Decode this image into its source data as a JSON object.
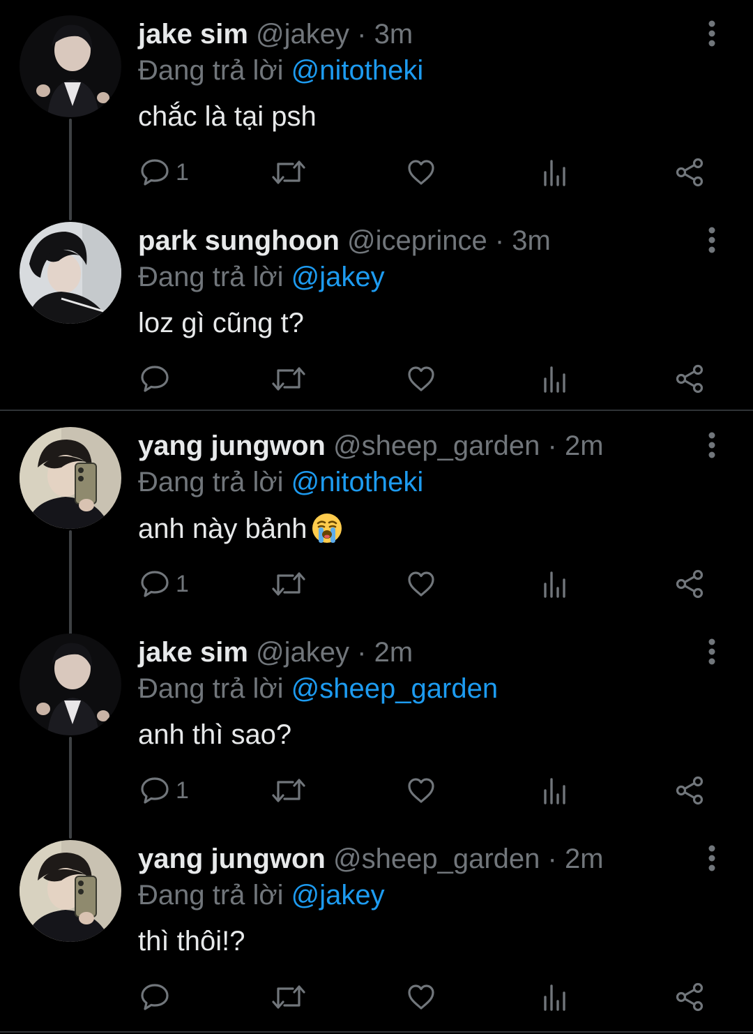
{
  "theme": {
    "background": "#000000",
    "text": "#e7e9ea",
    "muted": "#71767b",
    "link": "#1d9bf0",
    "divider": "#2f3336"
  },
  "tweets": [
    {
      "name": "jake sim",
      "handle": "@jakey",
      "separator": "·",
      "time": "3m",
      "reply_prefix": "Đang trả lời",
      "reply_to": "@nitotheki",
      "text": "chắc là tại psh",
      "emoji": "",
      "reply_count": "1",
      "avatar": "jake-sim-avatar"
    },
    {
      "name": "park sunghoon",
      "handle": "@iceprince",
      "separator": "·",
      "time": "3m",
      "reply_prefix": "Đang trả lời",
      "reply_to": "@jakey",
      "text": "loz gì cũng t?",
      "emoji": "",
      "reply_count": "",
      "avatar": "park-sunghoon-avatar"
    },
    {
      "name": "yang jungwon",
      "handle": "@sheep_garden",
      "separator": "·",
      "time": "2m",
      "reply_prefix": "Đang trả lời",
      "reply_to": "@nitotheki",
      "text": "anh này bảnh",
      "emoji": "loudly-crying-face",
      "reply_count": "1",
      "avatar": "yang-jungwon-avatar"
    },
    {
      "name": "jake sim",
      "handle": "@jakey",
      "separator": "·",
      "time": "2m",
      "reply_prefix": "Đang trả lời",
      "reply_to": "@sheep_garden",
      "text": "anh thì sao?",
      "emoji": "",
      "reply_count": "1",
      "avatar": "jake-sim-avatar"
    },
    {
      "name": "yang jungwon",
      "handle": "@sheep_garden",
      "separator": "·",
      "time": "2m",
      "reply_prefix": "Đang trả lời",
      "reply_to": "@jakey",
      "text": "thì thôi!?",
      "emoji": "",
      "reply_count": "",
      "avatar": "yang-jungwon-avatar"
    }
  ],
  "icons": {
    "more": "vertical-ellipsis-icon",
    "reply": "speech-bubble-icon",
    "retweet": "retweet-arrows-icon",
    "like": "heart-outline-icon",
    "views": "bar-chart-icon",
    "share": "share-nodes-icon"
  }
}
